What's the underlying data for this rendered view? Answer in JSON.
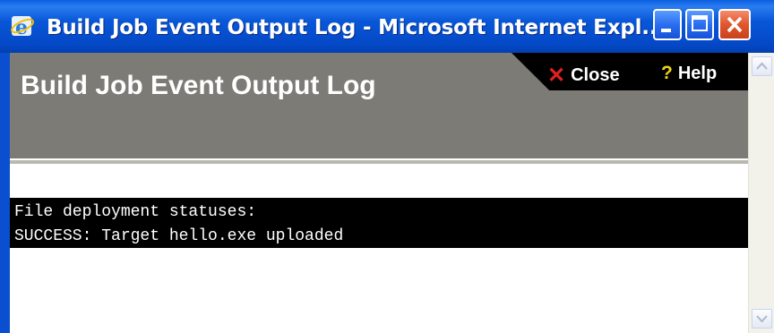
{
  "window": {
    "title": "Build Job Event Output Log - Microsoft Internet Expl...",
    "icon": "ie-icon",
    "controls": [
      "minimize-icon",
      "maximize-icon",
      "close-icon"
    ]
  },
  "header": {
    "title": "Build Job Event Output Log",
    "close_label": "Close",
    "help_label": "Help",
    "close_glyph": "✕",
    "help_glyph": "?"
  },
  "log": {
    "lines": [
      "File deployment statuses:",
      "SUCCESS: Target hello.exe uploaded"
    ]
  },
  "colors": {
    "titlebar": "#0548c8",
    "header_bg": "#7c7b75",
    "log_bg": "#000000",
    "close_x": "#e02020",
    "help_q": "#f2d21a"
  }
}
